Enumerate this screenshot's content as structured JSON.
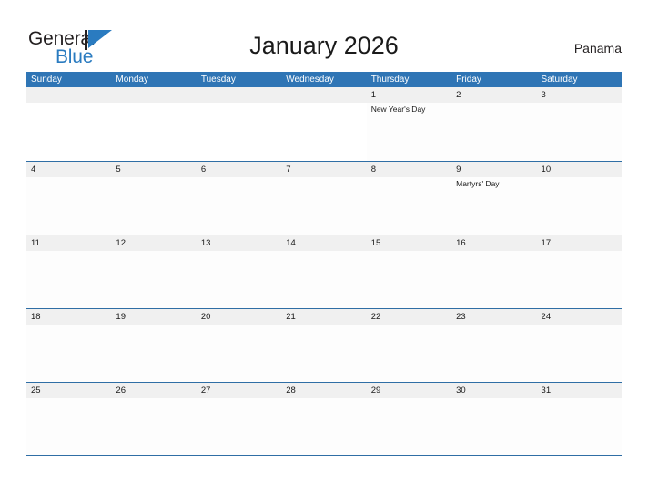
{
  "brand": {
    "name_part1": "General",
    "name_part2": "Blue",
    "flag_color": "#2a7bc0",
    "text_color": "#231f20"
  },
  "header": {
    "title": "January 2026",
    "country": "Panama"
  },
  "theme": {
    "header_blue": "#2f75b5",
    "row_line_blue": "#2f6ea5",
    "date_band_gray": "#f0f0f0",
    "text_dark": "#1a1a1a",
    "header_text": "#ffffff"
  },
  "calendar": {
    "month": "January",
    "year": "2026",
    "weekdays": [
      "Sunday",
      "Monday",
      "Tuesday",
      "Wednesday",
      "Thursday",
      "Friday",
      "Saturday"
    ],
    "weeks": [
      [
        {
          "date": "",
          "events": []
        },
        {
          "date": "",
          "events": []
        },
        {
          "date": "",
          "events": []
        },
        {
          "date": "",
          "events": []
        },
        {
          "date": "1",
          "events": [
            "New Year's Day"
          ]
        },
        {
          "date": "2",
          "events": []
        },
        {
          "date": "3",
          "events": []
        }
      ],
      [
        {
          "date": "4",
          "events": []
        },
        {
          "date": "5",
          "events": []
        },
        {
          "date": "6",
          "events": []
        },
        {
          "date": "7",
          "events": []
        },
        {
          "date": "8",
          "events": []
        },
        {
          "date": "9",
          "events": [
            "Martyrs' Day"
          ]
        },
        {
          "date": "10",
          "events": []
        }
      ],
      [
        {
          "date": "11",
          "events": []
        },
        {
          "date": "12",
          "events": []
        },
        {
          "date": "13",
          "events": []
        },
        {
          "date": "14",
          "events": []
        },
        {
          "date": "15",
          "events": []
        },
        {
          "date": "16",
          "events": []
        },
        {
          "date": "17",
          "events": []
        }
      ],
      [
        {
          "date": "18",
          "events": []
        },
        {
          "date": "19",
          "events": []
        },
        {
          "date": "20",
          "events": []
        },
        {
          "date": "21",
          "events": []
        },
        {
          "date": "22",
          "events": []
        },
        {
          "date": "23",
          "events": []
        },
        {
          "date": "24",
          "events": []
        }
      ],
      [
        {
          "date": "25",
          "events": []
        },
        {
          "date": "26",
          "events": []
        },
        {
          "date": "27",
          "events": []
        },
        {
          "date": "28",
          "events": []
        },
        {
          "date": "29",
          "events": []
        },
        {
          "date": "30",
          "events": []
        },
        {
          "date": "31",
          "events": []
        }
      ]
    ]
  }
}
